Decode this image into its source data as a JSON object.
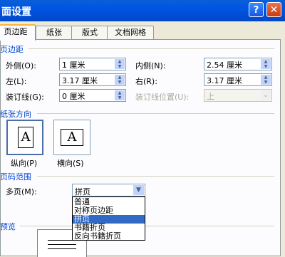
{
  "window": {
    "title": "面设置",
    "help_label": "?",
    "close_label": "✕"
  },
  "tabs": [
    {
      "label": "页边距",
      "active": true
    },
    {
      "label": "纸张"
    },
    {
      "label": "版式"
    },
    {
      "label": "文档网格"
    }
  ],
  "margins": {
    "section_title": "页边距",
    "outer_label": "外侧(O):",
    "outer_value": "1 厘米",
    "inner_label": "内侧(N):",
    "inner_value": "2.54 厘米",
    "left_label": "左(L):",
    "left_value": "3.17 厘米",
    "right_label": "右(R):",
    "right_value": "3.17 厘米",
    "gutter_label": "装订线(G):",
    "gutter_value": "0 厘米",
    "gutter_pos_label": "装订线位置(U):",
    "gutter_pos_value": "上"
  },
  "orientation": {
    "section_title": "纸张方向",
    "icon_letter": "A",
    "portrait_label": "纵向(P)",
    "landscape_label": "横向(S)"
  },
  "pages": {
    "section_title": "页码范围",
    "multiple_label": "多页(M):",
    "selected": "拼页",
    "options": [
      "普通",
      "对称页边距",
      "拼页",
      "书籍折页",
      "反向书籍折页"
    ],
    "highlighted_index": 2
  },
  "preview": {
    "section_title": "预览"
  }
}
